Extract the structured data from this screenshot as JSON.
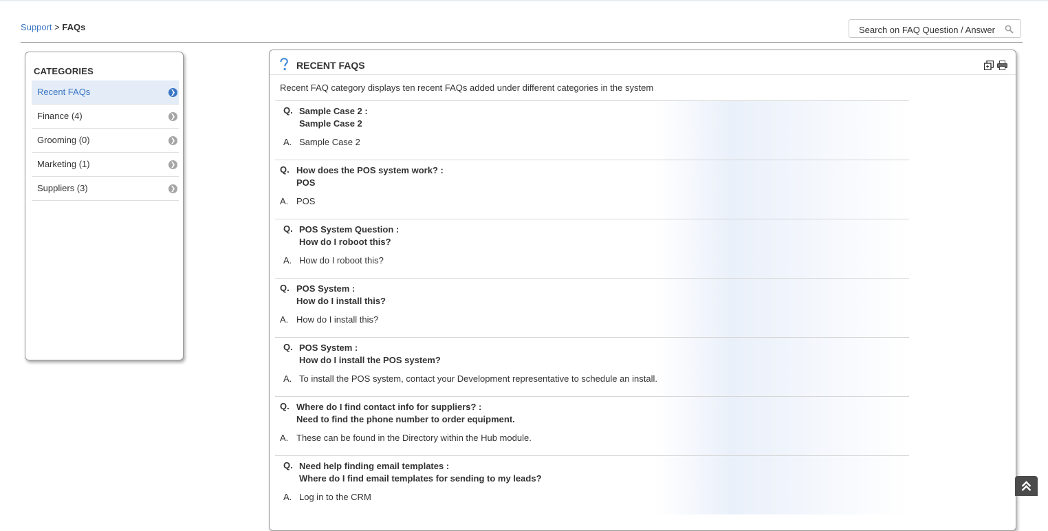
{
  "breadcrumb": {
    "link": "Support",
    "separator": ">",
    "current": "FAQs"
  },
  "search": {
    "placeholder": "Search on FAQ Question / Answer",
    "icon": "search-icon"
  },
  "sidebar": {
    "title": "CATEGORIES",
    "items": [
      {
        "label": "Recent FAQs",
        "active": true
      },
      {
        "label": "Finance (4)",
        "active": false
      },
      {
        "label": "Grooming (0)",
        "active": false
      },
      {
        "label": "Marketing (1)",
        "active": false
      },
      {
        "label": "Suppliers (3)",
        "active": false
      }
    ]
  },
  "panel": {
    "title": "RECENT FAQS",
    "description": "Recent FAQ category displays ten recent FAQs added under different categories in the system",
    "icons": [
      "help-icon",
      "expand-icon",
      "print-icon"
    ]
  },
  "faqs": [
    {
      "q_prefix": "Q.",
      "question": "Sample Case 2 :",
      "sub": "Sample Case 2",
      "a_prefix": "A.",
      "answer": "Sample Case 2"
    },
    {
      "q_prefix": "Q.",
      "question": "How does the POS system work? :",
      "sub": "POS",
      "a_prefix": "A.",
      "answer": "POS"
    },
    {
      "q_prefix": "Q.",
      "question": "POS System Question :",
      "sub": "How do I roboot this?",
      "a_prefix": "A.",
      "answer": "How do I roboot this?"
    },
    {
      "q_prefix": "Q.",
      "question": "POS System :",
      "sub": "How do I install this?",
      "a_prefix": "A.",
      "answer": "How do I install this?"
    },
    {
      "q_prefix": "Q.",
      "question": "POS System :",
      "sub": "How do I install the POS system?",
      "a_prefix": "A.",
      "answer": "To install the POS system, contact your Development representative to schedule an install."
    },
    {
      "q_prefix": "Q.",
      "question": "Where do I find contact info for suppliers? :",
      "sub": "Need to find the phone number to order equipment.",
      "a_prefix": "A.",
      "answer": "These can be found in the Directory within the Hub module."
    },
    {
      "q_prefix": "Q.",
      "question": "Need help finding email templates :",
      "sub": "Where do I find email templates for sending to my leads?",
      "a_prefix": "A.",
      "answer": "Log in to the CRM"
    }
  ],
  "colors": {
    "link": "#3a76c4",
    "active_bg": "#e3ecf7",
    "border": "#9a9a9a"
  }
}
